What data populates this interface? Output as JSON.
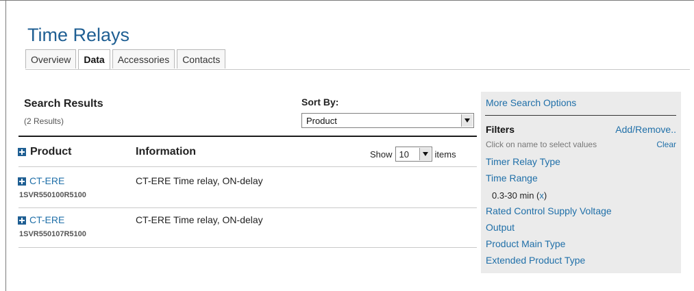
{
  "page": {
    "title": "Time Relays"
  },
  "tabs": [
    {
      "label": "Overview"
    },
    {
      "label": "Data",
      "active": true
    },
    {
      "label": "Accessories"
    },
    {
      "label": "Contacts"
    }
  ],
  "search": {
    "title": "Search Results",
    "count": "(2 Results)",
    "sort_label": "Sort By:",
    "sort_value": "Product"
  },
  "table": {
    "col_product": "Product",
    "col_information": "Information",
    "show_label": "Show",
    "show_value": "10",
    "items_label": "items",
    "rows": [
      {
        "name": "CT-ERE",
        "code": "1SVR550100R5100",
        "info": "CT-ERE Time relay, ON-delay"
      },
      {
        "name": "CT-ERE",
        "code": "1SVR550107R5100",
        "info": "CT-ERE Time relay, ON-delay"
      }
    ]
  },
  "sidebar": {
    "more_options": "More Search Options",
    "filters_label": "Filters",
    "add_remove": "Add/Remove..",
    "hint": "Click on name to select values",
    "clear": "Clear",
    "filters": [
      "Timer Relay Type",
      "Time Range",
      "Rated Control Supply Voltage",
      "Output",
      "Product Main Type",
      "Extended Product Type"
    ],
    "time_range_value": "0.3-30 min",
    "remove_value": "x"
  },
  "colors": {
    "link": "#1f6fa8",
    "title": "#1f5f93",
    "sidebar_bg": "#ebebeb"
  }
}
